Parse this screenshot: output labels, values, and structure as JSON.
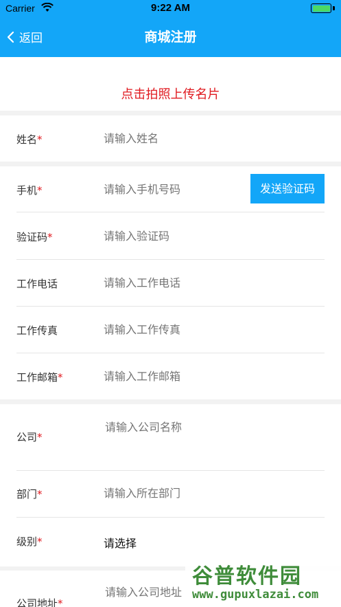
{
  "status_bar": {
    "carrier": "Carrier",
    "time": "9:22 AM",
    "battery_level": 1.0
  },
  "nav": {
    "back_label": "返回",
    "title": "商城注册",
    "background": "#13a6f8"
  },
  "upload": {
    "label": "点击拍照上传名片",
    "color": "#e0191f"
  },
  "form": {
    "name": {
      "label": "姓名",
      "required": "*",
      "placeholder": "请输入姓名"
    },
    "phone": {
      "label": "手机",
      "required": "*",
      "placeholder": "请输入手机号码",
      "send_code_label": "发送验证码"
    },
    "code": {
      "label": "验证码",
      "required": "*",
      "placeholder": "请输入验证码"
    },
    "work_phone": {
      "label": "工作电话",
      "placeholder": "请输入工作电话"
    },
    "work_fax": {
      "label": "工作传真",
      "placeholder": "请输入工作传真"
    },
    "work_email": {
      "label": "工作邮箱",
      "required": "*",
      "placeholder": "请输入工作邮箱"
    },
    "company": {
      "label": "公司",
      "required": "*",
      "placeholder": "请输入公司名称"
    },
    "department": {
      "label": "部门",
      "required": "*",
      "placeholder": "请输入所在部门"
    },
    "level": {
      "label": "级别",
      "required": "*",
      "value": "请选择"
    },
    "company_address": {
      "label": "公司地址",
      "required": "*",
      "placeholder": "请输入公司地址"
    }
  },
  "watermark": {
    "title": "谷普软件园",
    "url": "www.gupuxlazai.com"
  },
  "icons": {
    "back": "chevron-left-icon",
    "wifi": "wifi-icon",
    "battery": "battery-icon"
  }
}
